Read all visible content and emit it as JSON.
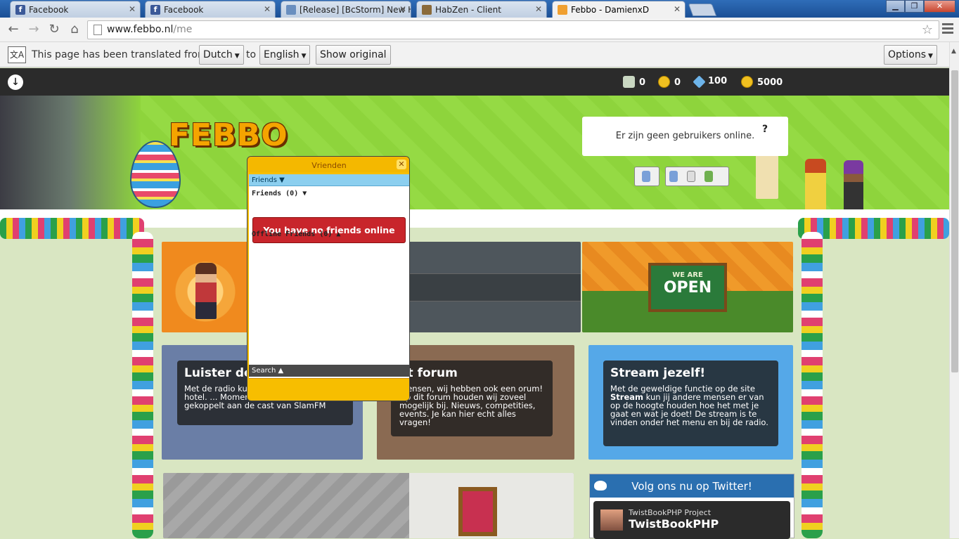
{
  "browser": {
    "tabs": [
      {
        "title": "Facebook",
        "icon": "facebook-icon"
      },
      {
        "title": "Facebook",
        "icon": "facebook-icon"
      },
      {
        "title": "[Release] [BcStorm] New H",
        "icon": "ragezone-icon"
      },
      {
        "title": "HabZen - Client",
        "icon": "habzen-icon"
      },
      {
        "title": "Febbo - DamienxD",
        "icon": "febbo-icon",
        "active": true
      }
    ],
    "url_domain": "www.febbo.nl",
    "url_path": "/me"
  },
  "translate_bar": {
    "message": "This page has been translated from",
    "from_language": "Dutch",
    "to_word": "to",
    "to_language": "English",
    "show_original": "Show original",
    "options": "Options"
  },
  "site": {
    "logo": "FEBBO",
    "currencies": [
      {
        "icon": "duckets-icon",
        "value": "0"
      },
      {
        "icon": "coin-icon",
        "value": "0"
      },
      {
        "icon": "diamond-icon",
        "value": "100"
      },
      {
        "icon": "credits-icon",
        "value": "5000"
      }
    ],
    "online_message": "Er zijn geen gebruikers online.",
    "open_sign": {
      "line1": "WE ARE",
      "line2": "OPEN"
    },
    "radio": {
      "title": "Luister de",
      "text": "Met de radio kun ... vervelen in het hotel. ... Momenteel is de radio gekoppelt aan de cast van SlamFM"
    },
    "forum": {
      "title": "et forum",
      "text": "mensen, wij hebben ook een orum! Op dit forum houden wij zoveel mogelijk bij. Nieuws, competities, events. Je kan hier echt alles vragen!"
    },
    "stream": {
      "title": "Stream jezelf!",
      "text_pre": "Met de geweldige functie op de site",
      "text_bold": "Stream",
      "text_post": "kun jij andere mensen er van op de hoogte houden hoe het met je gaat en wat je doet! De stream is te vinden onder het menu en bij de radio."
    },
    "twitter": {
      "header": "Volg ons nu op Twitter!",
      "account_sub": "TwistBookPHP Project",
      "account_name": "TwistBookPHP"
    }
  },
  "friends_panel": {
    "title": "Vrienden",
    "tab": "Friends",
    "online_category": "Friends (0)",
    "no_friends": "You have no friends online",
    "offline_category": "Offline Friends (0)",
    "search": "Search"
  }
}
